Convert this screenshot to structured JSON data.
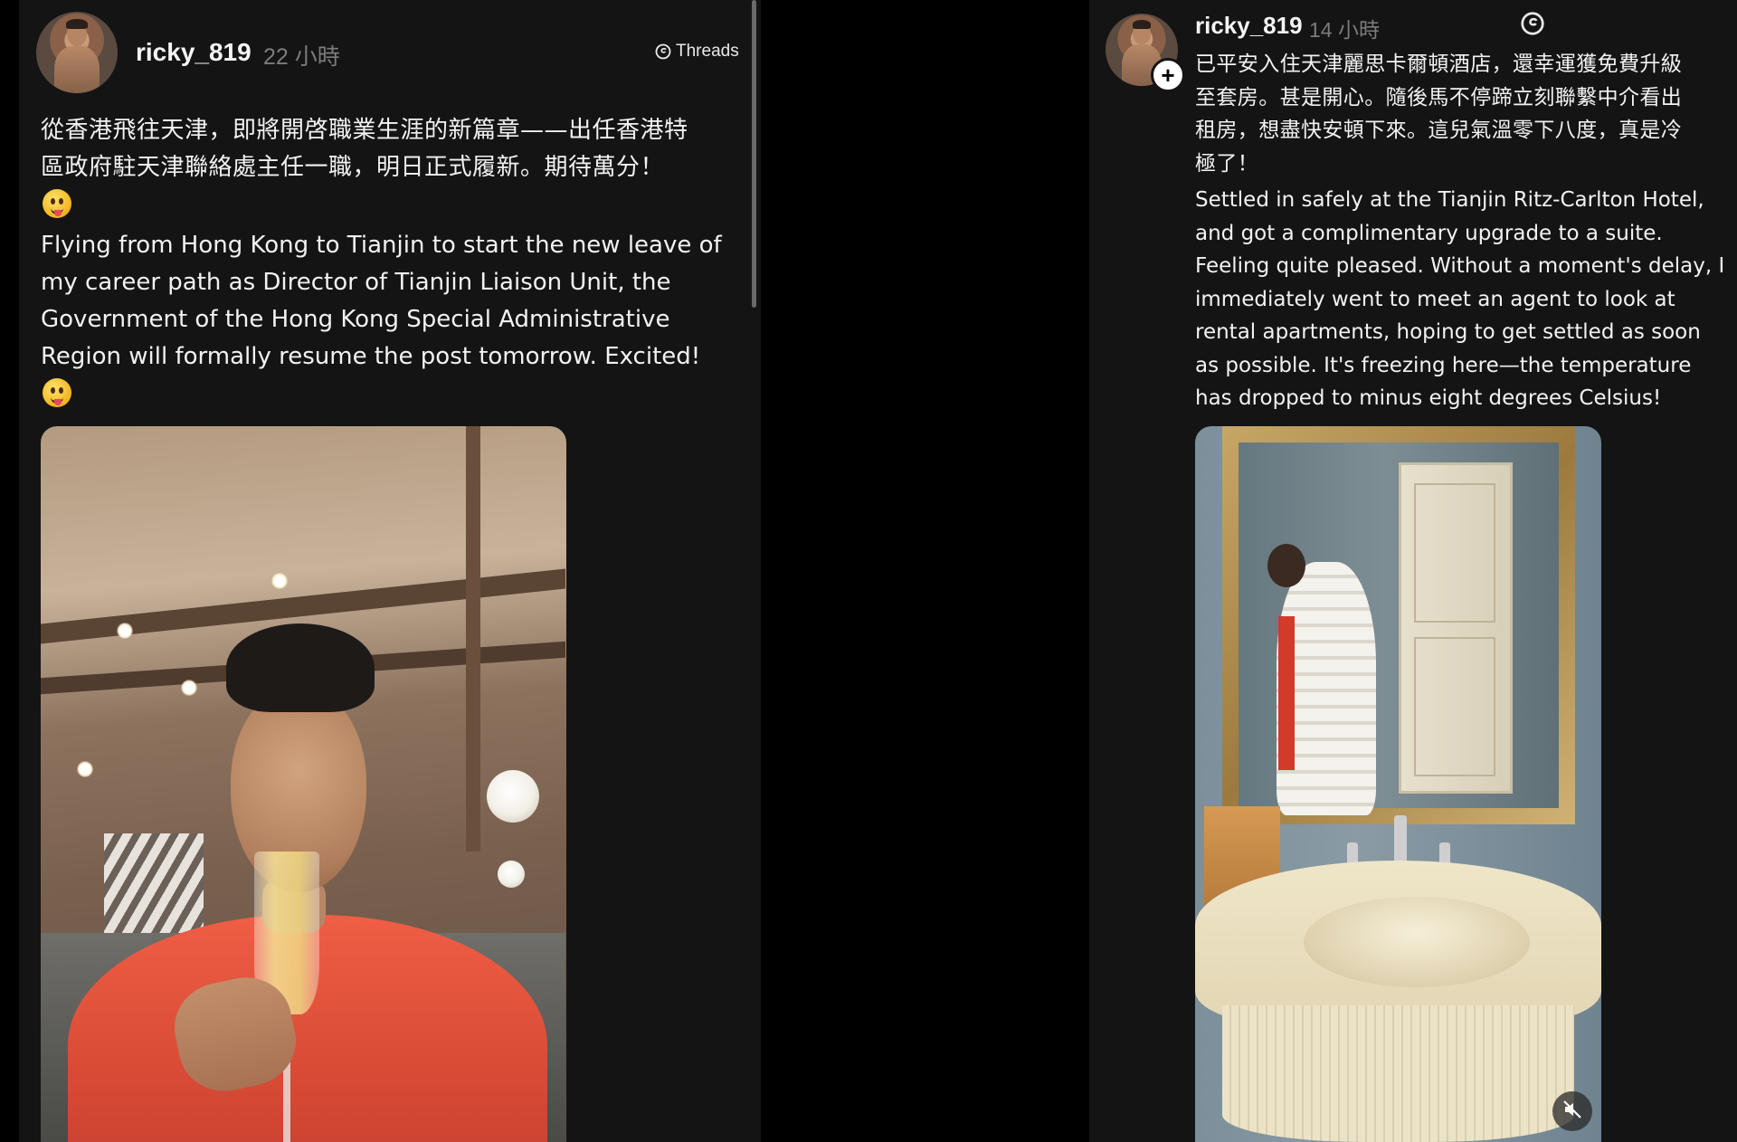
{
  "left_post": {
    "username": "ricky_819",
    "time": "22 小時",
    "threads_label": "Threads",
    "text_zh_line1": "從香港飛往天津，即將開啓職業生涯的新篇章——出任香港特",
    "text_zh_line2": "區政府駐天津聯絡處主任一職，明日正式履新。期待萬分！",
    "text_en_line1": "Flying from Hong Kong to Tianjin to start the new leave of",
    "text_en_line2": "my career path as Director of Tianjin Liaison Unit, the",
    "text_en_line3": "Government of the Hong Kong Special Administrative",
    "text_en_line4": "Region will formally resume the post tomorrow. Excited!"
  },
  "right_post": {
    "username": "ricky_819",
    "time": "14 小時",
    "text_zh_line1": "已平安入住天津麗思卡爾頓酒店，還幸運獲免費升級",
    "text_zh_line2": "至套房。甚是開心。隨後馬不停蹄立刻聯繫中介看出",
    "text_zh_line3": "租房，想盡快安頓下來。這兒氣溫零下八度，真是冷",
    "text_zh_line4": "極了！",
    "text_en_line1": "Settled in safely at the Tianjin Ritz-Carlton Hotel,",
    "text_en_line2": "and got a complimentary upgrade to a suite.",
    "text_en_line3": "Feeling quite pleased. Without a moment's delay, I",
    "text_en_line4": "immediately went to meet an agent to look at",
    "text_en_line5": "rental apartments, hoping to get settled as soon",
    "text_en_line6": "as possible. It's freezing here—the temperature",
    "text_en_line7": "has dropped to minus eight degrees Celsius!",
    "follow_symbol": "+"
  },
  "icons": {
    "threads": "threads-icon",
    "emoji": "tongue-out-emoji",
    "mute": "speaker-muted-icon",
    "follow": "plus-icon"
  },
  "colors": {
    "background": "#000000",
    "panel": "#141414",
    "text": "#f2f2f2",
    "timestamp": "#7c7c7c"
  }
}
